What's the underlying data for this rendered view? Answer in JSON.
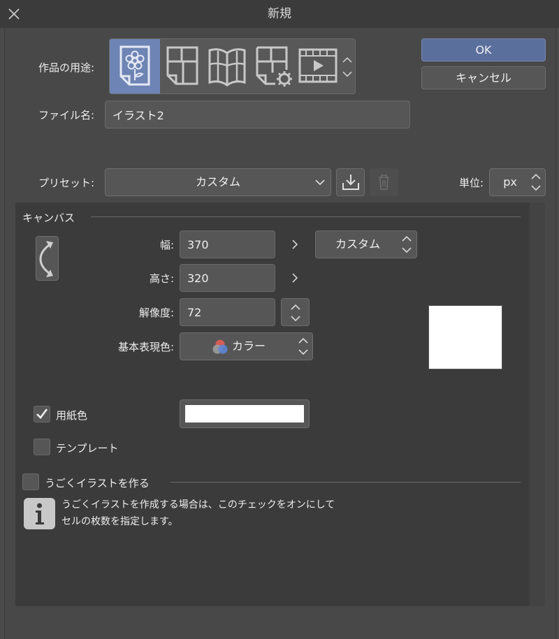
{
  "window": {
    "title": "新規"
  },
  "purpose": {
    "label": "作品の用途:",
    "options": [
      "illustration",
      "comic",
      "book",
      "comic-settings",
      "animation"
    ],
    "selected_index": 0
  },
  "buttons": {
    "ok": "OK",
    "cancel": "キャンセル"
  },
  "filename": {
    "label": "ファイル名:",
    "value": "イラスト2"
  },
  "preset": {
    "label": "プリセット:",
    "value": "カスタム"
  },
  "unit": {
    "label": "単位:",
    "value": "px"
  },
  "canvas": {
    "section_title": "キャンバス",
    "width_label": "幅:",
    "width_value": "370",
    "height_label": "高さ:",
    "height_value": "320",
    "size_preset": "カスタム",
    "resolution_label": "解像度:",
    "resolution_value": "72",
    "color_label": "基本表現色:",
    "color_value": "カラー",
    "paper_color_label": "用紙色",
    "paper_color_checked": true,
    "paper_color": "#ffffff",
    "template_label": "テンプレート",
    "template_checked": false
  },
  "animation": {
    "label": "うごくイラストを作る",
    "checked": false,
    "info_line1": "うごくイラストを作成する場合は、このチェックをオンにして",
    "info_line2": "セルの枚数を指定します。"
  },
  "colors": {
    "accent": "#6e84b4",
    "ok_button": "#5b6f9c",
    "panel": "#3b3b3b",
    "field": "#565656"
  },
  "icons": [
    "close-icon",
    "illustration-icon",
    "comic-icon",
    "book-icon",
    "comic-settings-icon",
    "animation-icon",
    "scroll-updown-icon",
    "chevron-down-icon",
    "save-preset-icon",
    "trash-icon",
    "rotate-orientation-icon",
    "chevron-right-icon",
    "color-mode-icon",
    "check-icon",
    "info-icon"
  ]
}
